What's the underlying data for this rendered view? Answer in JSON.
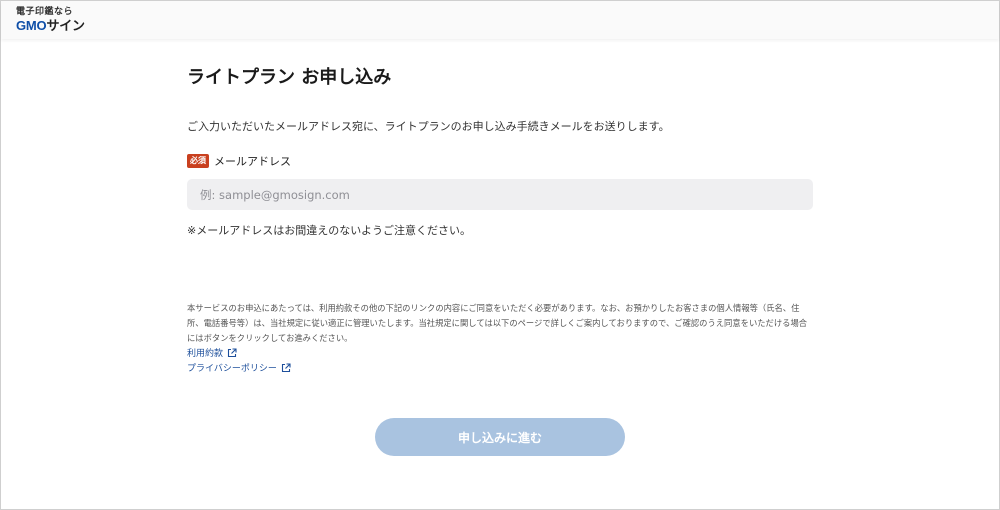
{
  "header": {
    "logo_tagline": "電子印鑑なら",
    "logo_brand": "GMO",
    "logo_product": "サイン"
  },
  "form": {
    "title": "ライトプラン お申し込み",
    "lead": "ご入力いただいたメールアドレス宛に、ライトプランのお申し込み手続きメールをお送りします。",
    "required_badge": "必須",
    "email_label": "メールアドレス",
    "email_placeholder": "例: sample@gmosign.com",
    "email_value": "",
    "note": "※メールアドレスはお間違えのないようご注意ください。",
    "terms_text": "本サービスのお申込にあたっては、利用約款その他の下記のリンクの内容にご同意をいただく必要があります。なお、お預かりしたお客さまの個人情報等（氏名、住所、電話番号等）は、当社規定に従い適正に管理いたします。当社規定に関しては以下のページで詳しくご案内しておりますので、ご確認のうえ同意をいただける場合にはボタンをクリックしてお進みください。",
    "link_terms": "利用約款",
    "link_privacy": "プライバシーポリシー",
    "submit_label": "申し込みに進む"
  },
  "colors": {
    "brand_blue": "#0f4fa8",
    "required_red": "#c9401f",
    "link_blue": "#1d4f9b",
    "button_disabled": "#a9c3e0",
    "input_bg": "#efeff1"
  },
  "icons": {
    "external_link": "external-link-icon"
  }
}
